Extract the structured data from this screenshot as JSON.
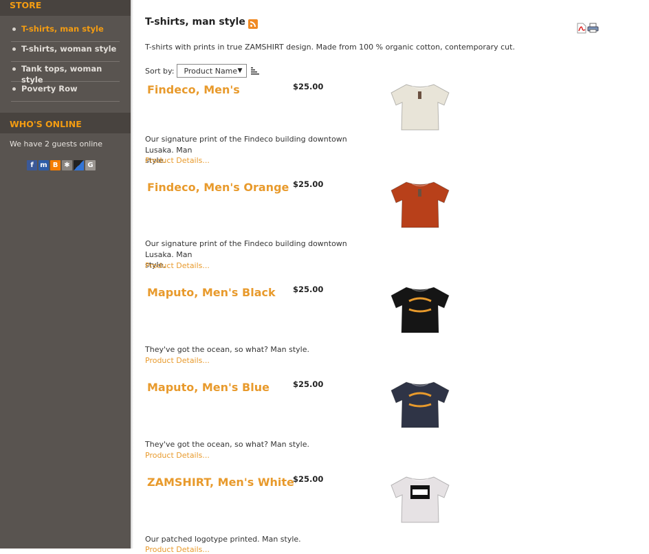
{
  "sidebar": {
    "store_title": "STORE",
    "menu": [
      {
        "label": "T-shirts, man style",
        "active": true
      },
      {
        "label": "T-shirts, woman style",
        "active": false
      },
      {
        "label": "Tank tops, woman style",
        "active": false
      },
      {
        "label": "Poverty Row",
        "active": false
      }
    ],
    "online_title": "WHO'S ONLINE",
    "online_text": "We have 2 guests online",
    "social_icons": [
      "facebook-icon",
      "myspace-icon",
      "blogger-icon",
      "friends-icon",
      "delicious-icon",
      "google-icon"
    ]
  },
  "main": {
    "category_title": "T-shirts, man style",
    "description": "T-shirts with prints in true ZAMSHIRT design. Made from 100 % organic cotton, contemporary cut.",
    "sort_label": "Sort by:",
    "sort_value": "Product Name",
    "details_label": "Product Details...",
    "products": [
      {
        "name": "Findeco, Men's",
        "price": "$25.00",
        "desc_line1": "Our signature print of the Findeco building downtown Lusaka. Man",
        "desc_line2": "style.",
        "shirt_color": "#e8e4d8",
        "print": "small"
      },
      {
        "name": "Findeco, Men's Orange",
        "price": "$25.00",
        "desc_line1": "Our signature print of the Findeco building downtown Lusaka. Man",
        "desc_line2": "style.",
        "shirt_color": "#b8401a",
        "print": "small"
      },
      {
        "name": "Maputo, Men's Black",
        "price": "$25.00",
        "desc_line1": "They've got the ocean, so what? Man style.",
        "desc_line2": "",
        "shirt_color": "#151515",
        "print": "arc"
      },
      {
        "name": "Maputo, Men's Blue",
        "price": "$25.00",
        "desc_line1": "They've got the ocean, so what? Man style.",
        "desc_line2": "",
        "shirt_color": "#2f3446",
        "print": "arc"
      },
      {
        "name": "ZAMSHIRT, Men's White",
        "price": "$25.00",
        "desc_line1": "Our patched logotype printed. Man style.",
        "desc_line2": "",
        "shirt_color": "#e6e2e4",
        "print": "patch"
      }
    ]
  },
  "colors": {
    "accent": "#f39c12",
    "sidebar_bg": "#595450",
    "link": "#e89a2c"
  }
}
